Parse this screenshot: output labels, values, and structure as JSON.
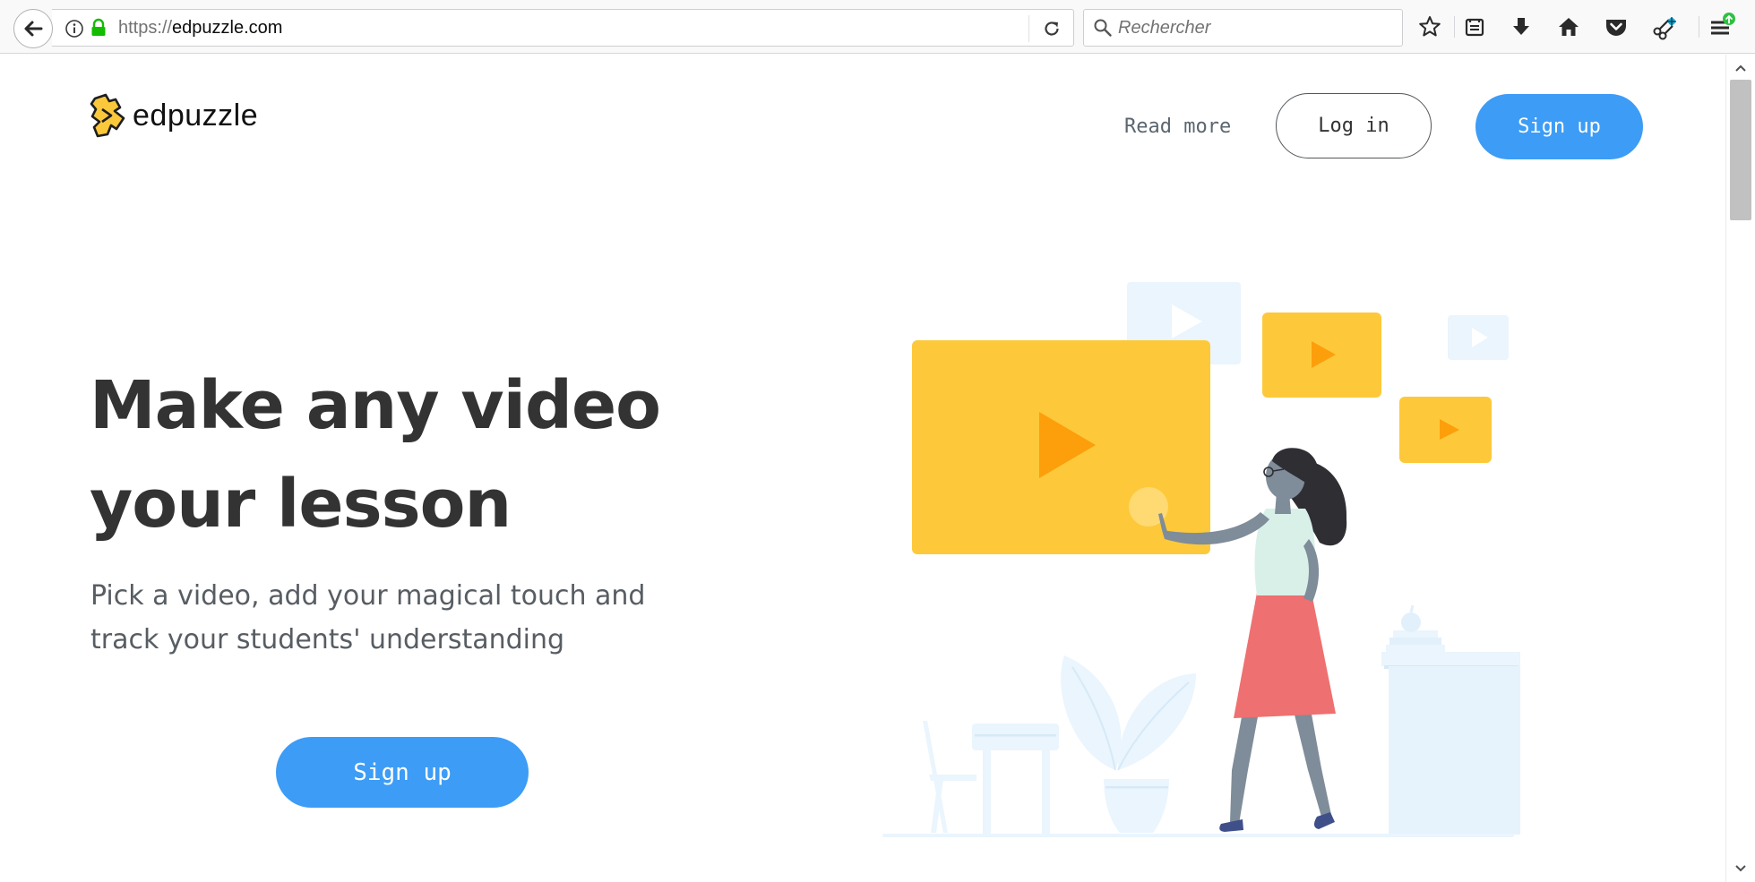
{
  "browser": {
    "url_protocol": "https://",
    "url_host": "edpuzzle.com",
    "search_placeholder": "Rechercher",
    "icons": [
      "back-arrow-icon",
      "info-icon",
      "lock-icon",
      "reload-icon",
      "search-icon",
      "star-icon",
      "reading-list-icon",
      "download-icon",
      "home-icon",
      "pocket-icon",
      "customize-icon",
      "menu-icon"
    ],
    "update_badge_color": "#30c041"
  },
  "header": {
    "logo_text": "edpuzzle",
    "logo_color": "#fcc83b",
    "nav": {
      "read_more": "Read more",
      "login": "Log in",
      "signup": "Sign up"
    }
  },
  "hero": {
    "title_line1": "Make any video",
    "title_line2": "your lesson",
    "subtitle_line1": "Pick a video, add your magical touch and",
    "subtitle_line2": "track your students' understanding",
    "signup": "Sign up"
  },
  "colors": {
    "primary_blue": "#3d9cf5",
    "video_yellow": "#fdc93a",
    "play_orange": "#fd9e0b",
    "skirt_red": "#ee7070",
    "skin_gray": "#7f8c99",
    "pale_blue": "#eaf5fd"
  }
}
